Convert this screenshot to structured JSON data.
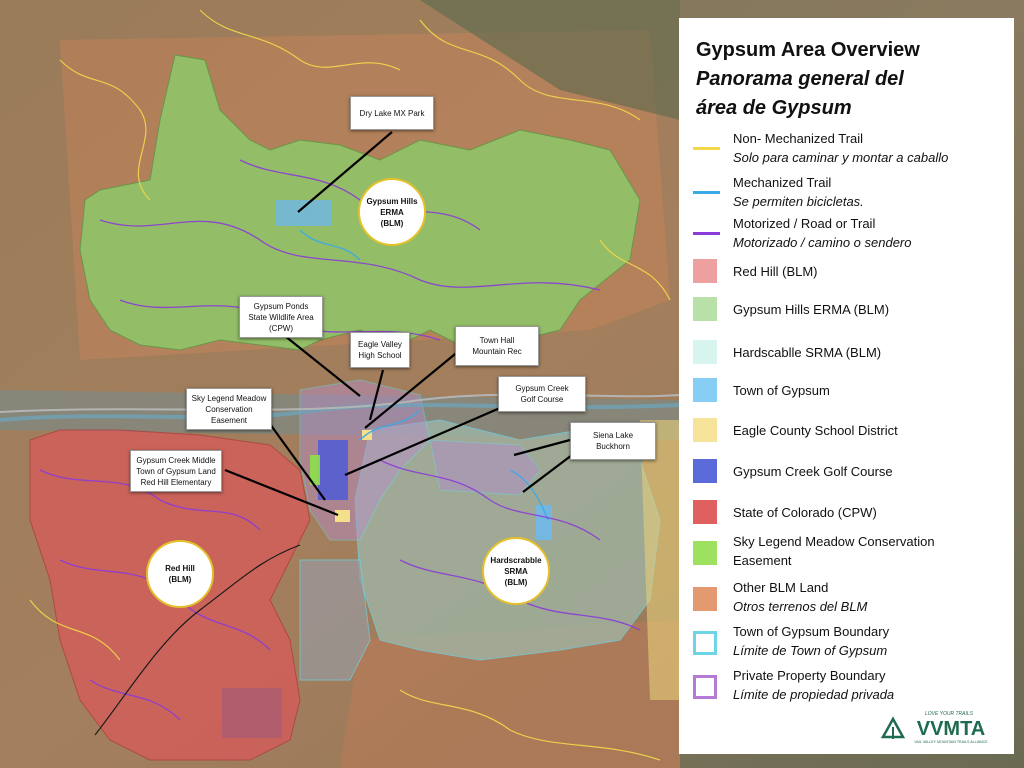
{
  "map": {
    "colors": {
      "non_mechanized_trail": "#f2d84a",
      "mechanized_trail": "#3ba9e8",
      "motorized": "#8b3bd8",
      "red_hill": "#e88a8a",
      "gypsum_hills_erma": "#9fd07f",
      "hardscrabble_srma": "#cfeee4",
      "town_of_gypsum": "#7fc9ee",
      "eagle_county_school": "#f4e08a",
      "gypsum_creek_golf": "#4e5bd6",
      "state_of_colorado": "#e05050",
      "sky_legend_meadow": "#8ee04a",
      "other_blm": "#e3946a",
      "town_boundary": "#6fd4e6",
      "private_boundary": "#b57ad6"
    },
    "callouts": [
      {
        "id": "dry-lake",
        "lines": [
          "Dry Lake MX Park"
        ]
      },
      {
        "id": "gypsum-ponds",
        "lines": [
          "Gypsum Ponds",
          "State Wildlife Area",
          "(CPW)"
        ]
      },
      {
        "id": "eagle-valley",
        "lines": [
          "Eagle Valley",
          "High School"
        ]
      },
      {
        "id": "town-hall",
        "lines": [
          "Town Hall",
          "Mountain Rec"
        ]
      },
      {
        "id": "sky-legend",
        "lines": [
          "Sky Legend Meadow",
          "Conservation",
          "Easement"
        ]
      },
      {
        "id": "gypsum-creek-golf",
        "lines": [
          "Gypsum Creek",
          "Golf Course"
        ]
      },
      {
        "id": "siena-lake",
        "lines": [
          "Siena Lake",
          "Buckhorn"
        ]
      },
      {
        "id": "gypsum-creek-middle",
        "lines": [
          "Gypsum Creek Middle",
          "Town of Gypsum Land",
          "Red Hill Elementary"
        ]
      }
    ],
    "area_labels": [
      {
        "id": "gypsum-hills",
        "lines": [
          "Gypsum Hills",
          "ERMA",
          "(BLM)"
        ]
      },
      {
        "id": "red-hill",
        "lines": [
          "Red Hill",
          "(BLM)"
        ]
      },
      {
        "id": "hardscrabble",
        "lines": [
          "Hardscrabble",
          "SRMA",
          "(BLM)"
        ]
      }
    ]
  },
  "legend": {
    "title_en": "Gypsum Area Overview",
    "title_es_1": "Panorama general del",
    "title_es_2": "área de Gypsum",
    "items": [
      {
        "kind": "line",
        "color": "#f2d84a",
        "label": "Non- Mechanized Trail",
        "sublabel": "Solo para caminar y montar a caballo"
      },
      {
        "kind": "line",
        "color": "#3ba9e8",
        "label": "Mechanized Trail",
        "sublabel": "Se permiten bicicletas."
      },
      {
        "kind": "line",
        "color": "#8b3bd8",
        "label": "Motorized / Road or Trail",
        "sublabel": "Motorizado / camino o sendero"
      },
      {
        "kind": "fill",
        "color": "#eea0a0",
        "label": "Red Hill (BLM)",
        "sublabel": ""
      },
      {
        "kind": "fill",
        "color": "#b8e0a8",
        "label": "Gypsum Hills ERMA (BLM)",
        "sublabel": ""
      },
      {
        "kind": "fill",
        "color": "#d8f4ee",
        "label": "Hardscablle SRMA (BLM)",
        "sublabel": ""
      },
      {
        "kind": "fill",
        "color": "#86cef4",
        "label": "Town of Gypsum",
        "sublabel": ""
      },
      {
        "kind": "fill",
        "color": "#f6e49a",
        "label": "Eagle County School District",
        "sublabel": ""
      },
      {
        "kind": "fill",
        "color": "#5a6ad8",
        "label": "Gypsum Creek Golf Course",
        "sublabel": ""
      },
      {
        "kind": "fill",
        "color": "#e06060",
        "label": "State of Colorado (CPW)",
        "sublabel": ""
      },
      {
        "kind": "fill",
        "color": "#9ee060",
        "label": "Sky Legend Meadow Conservation",
        "sublabel": "Easement",
        "sub_plain": true
      },
      {
        "kind": "fill",
        "color": "#e49a70",
        "label": "Other BLM Land",
        "sublabel": "Otros terrenos del BLM"
      },
      {
        "kind": "outline",
        "color": "#6fd4e6",
        "label": "Town of Gypsum Boundary",
        "sublabel": "Límite de Town of Gypsum"
      },
      {
        "kind": "outline",
        "color": "#b57ad6",
        "label": "Private Property Boundary",
        "sublabel": "Límite de propiedad privada"
      }
    ]
  },
  "logo": {
    "tagline": "LOVE YOUR TRAILS",
    "name": "VVMTA",
    "subtitle": "VAIL VALLEY MOUNTAIN TRAILS ALLIANCE",
    "color": "#1f6b4f"
  }
}
